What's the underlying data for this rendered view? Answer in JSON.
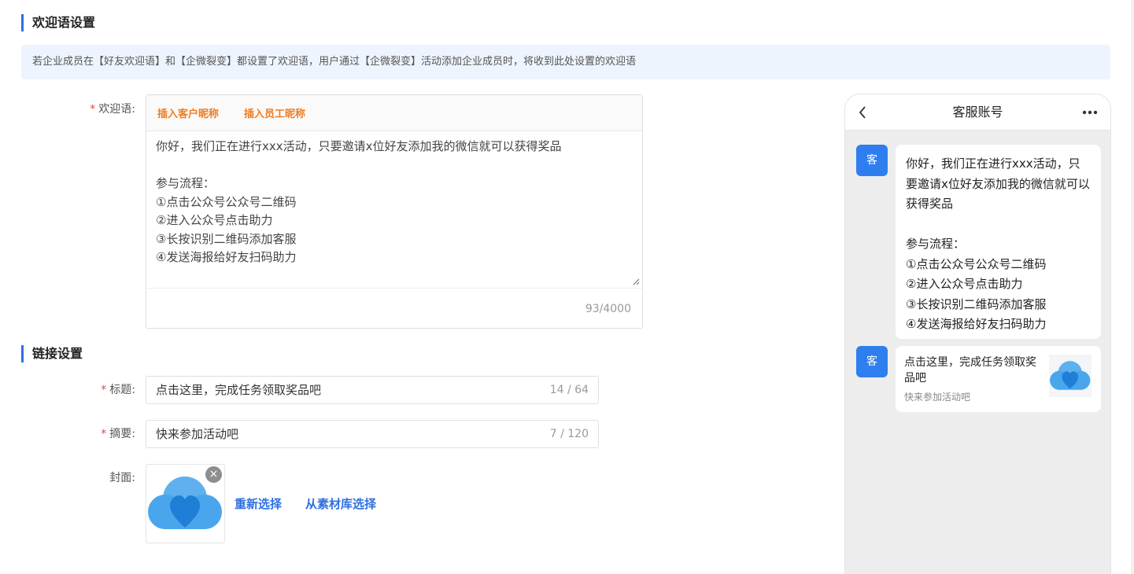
{
  "sections": {
    "welcome_title": "欢迎语设置",
    "link_title": "链接设置"
  },
  "notice": "若企业成员在【好友欢迎语】和【企微裂变】都设置了欢迎语，用户通过【企微裂变】活动添加企业成员时，将收到此处设置的欢迎语",
  "welcome": {
    "required_mark": "*",
    "label": "欢迎语:",
    "insert_customer_nickname": "插入客户昵称",
    "insert_employee_nickname": "插入员工昵称",
    "text": "你好，我们正在进行xxx活动，只要邀请x位好友添加我的微信就可以获得奖品\n\n参与流程：\n①点击公众号公众号二维码\n②进入公众号点击助力\n③长按识别二维码添加客服\n④发送海报给好友扫码助力",
    "counter": "93/4000"
  },
  "link": {
    "title_label": "标题:",
    "title_value": "点击这里，完成任务领取奖品吧",
    "title_counter": "14 / 64",
    "summary_label": "摘要:",
    "summary_value": "快来参加活动吧",
    "summary_counter": "7 / 120",
    "cover_label": "封面:",
    "close_icon_glyph": "×",
    "reselect": "重新选择",
    "from_library": "从素材库选择"
  },
  "preview": {
    "header_title": "客服账号",
    "avatar_text": "客",
    "message_text": "你好，我们正在进行xxx活动，只要邀请x位好友添加我的微信就可以获得奖品\n\n参与流程：\n①点击公众号公众号二维码\n②进入公众号点击助力\n③长按识别二维码添加客服\n④发送海报给好友扫码助力",
    "card_title": "点击这里，完成任务领取奖品吧",
    "card_desc": "快来参加活动吧"
  },
  "icons": {
    "back": "chevron-left-icon",
    "more": "more-dots-icon",
    "close": "close-icon",
    "cover": "cloud-heart-logo",
    "resize": "resize-grip-icon"
  },
  "colors": {
    "accent_blue": "#2f6fe0",
    "insert_orange": "#f07c1f",
    "required_red": "#e5484d",
    "notice_bg": "#eef4fd",
    "avatar_blue": "#2f7ef0"
  }
}
